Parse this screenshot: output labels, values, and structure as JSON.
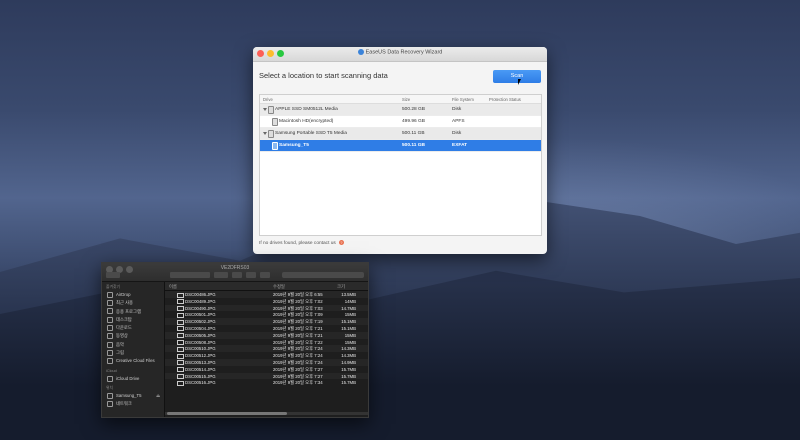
{
  "wizard": {
    "window_title": "EaseUS Data Recovery Wizard",
    "heading": "Select a location to start scanning data",
    "scan_button": "Scan",
    "columns": {
      "drive": "Drive",
      "size": "Size",
      "fs": "File System",
      "protection": "Protection Status"
    },
    "drives": [
      {
        "name": "APPLE SSD SM0512L Media",
        "size": "500.28 GB",
        "fs": "Disk",
        "type": "group"
      },
      {
        "name": "Macintosh HD(encrypted)",
        "size": "499.96 GB",
        "fs": "APFS",
        "type": "child"
      },
      {
        "name": "Samsung Portable SSD T5 Media",
        "size": "500.11 GB",
        "fs": "Disk",
        "type": "group"
      },
      {
        "name": "Samsung_T5",
        "size": "500.11 GB",
        "fs": "EXFAT",
        "type": "selected"
      }
    ],
    "footer": "If no drives found, please contact us",
    "help_icon": "?"
  },
  "finder": {
    "title": "VE2DFRS03",
    "sidebar": {
      "favorites_head": "즐겨찾기",
      "favorites": [
        "AirDrop",
        "최근 사용",
        "응용 프로그램",
        "데스크탑",
        "다운로드",
        "동영상",
        "음악",
        "그림",
        "Creative Cloud Files"
      ],
      "icloud_head": "iCloud",
      "icloud": [
        "iCloud Drive"
      ],
      "devices_head": "위치",
      "devices": [
        "Samsung_T5",
        "네트워크"
      ]
    },
    "columns": {
      "name": "이름",
      "date": "수정일",
      "size": "크기"
    },
    "files": [
      {
        "name": "DSC00486.JPG",
        "date": "2019년 9월 20일 오후 6:55",
        "size": "13.5MB"
      },
      {
        "name": "DSC00489.JPG",
        "date": "2019년 9월 20일 오후 7:02",
        "size": "14MB"
      },
      {
        "name": "DSC00490.JPG",
        "date": "2019년 9월 20일 오후 7:03",
        "size": "14.7MB"
      },
      {
        "name": "DSC00501.JPG",
        "date": "2019년 9월 20일 오후 7:09",
        "size": "15MB"
      },
      {
        "name": "DSC00502.JPG",
        "date": "2019년 9월 20일 오후 7:19",
        "size": "15.1MB"
      },
      {
        "name": "DSC00504.JPG",
        "date": "2019년 9월 20일 오후 7:21",
        "size": "15.1MB"
      },
      {
        "name": "DSC00505.JPG",
        "date": "2019년 9월 20일 오후 7:21",
        "size": "15MB"
      },
      {
        "name": "DSC00508.JPG",
        "date": "2019년 9월 20일 오후 7:22",
        "size": "15MB"
      },
      {
        "name": "DSC00510.JPG",
        "date": "2019년 9월 20일 오후 7:24",
        "size": "14.3MB"
      },
      {
        "name": "DSC00512.JPG",
        "date": "2019년 9월 20일 오후 7:24",
        "size": "14.3MB"
      },
      {
        "name": "DSC00513.JPG",
        "date": "2019년 9월 20일 오후 7:24",
        "size": "14.9MB"
      },
      {
        "name": "DSC00514.JPG",
        "date": "2019년 9월 20일 오후 7:27",
        "size": "15.7MB"
      },
      {
        "name": "DSC00515.JPG",
        "date": "2019년 9월 20일 오후 7:27",
        "size": "15.7MB"
      },
      {
        "name": "DSC00516.JPG",
        "date": "2019년 9월 20일 오후 7:34",
        "size": "15.7MB"
      }
    ]
  }
}
